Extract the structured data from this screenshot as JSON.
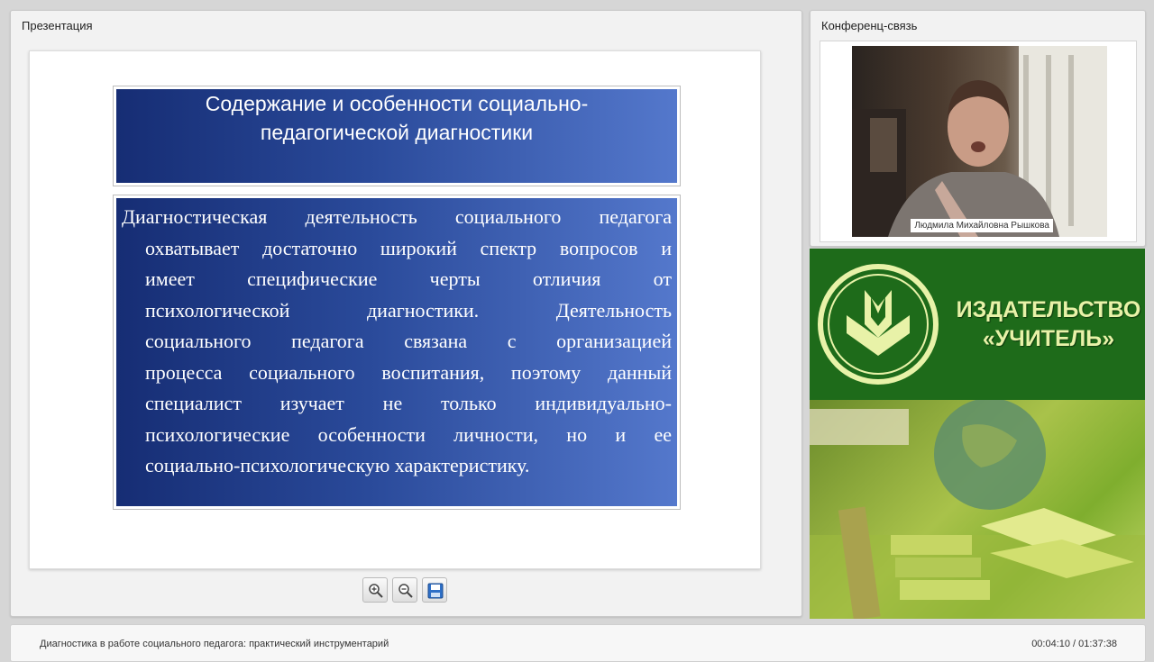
{
  "presentation": {
    "title": "Презентация",
    "slide": {
      "heading": "Содержание и особенности социально-педагогической диагностики",
      "body_lines": [
        "Диагностическая деятельность социального педагога",
        "охватывает достаточно широкий спектр вопросов и",
        "имеет специфические черты отличия от",
        "психологической диагностики. Деятельность",
        "социального педагога связана с организацией",
        "процесса социального воспитания, поэтому данный",
        "специалист изучает не только индивидуально-",
        "психологические особенности личности, но и ее",
        "социально-психологическую характеристику."
      ]
    },
    "toolbar": {
      "zoom_in": "zoom-in-icon",
      "zoom_out": "zoom-out-icon",
      "save": "save-icon"
    }
  },
  "conference": {
    "title": "Конференц-связь",
    "speaker_name": "Людмила Михайловна Рышкова"
  },
  "ad": {
    "brand_line1": "ИЗДАТЕЛЬСТВО",
    "brand_line2": "«УЧИТЕЛЬ»"
  },
  "footer": {
    "course_title": "Диагностика в работе социального педагога: практический инструментарий",
    "time": "00:04:10 / 01:37:38"
  },
  "colors": {
    "slide_gradient_dark": "#162d74",
    "slide_gradient_light": "#5478cc",
    "ad_green": "#1e6b1a",
    "ad_text": "#e8f2a8"
  }
}
